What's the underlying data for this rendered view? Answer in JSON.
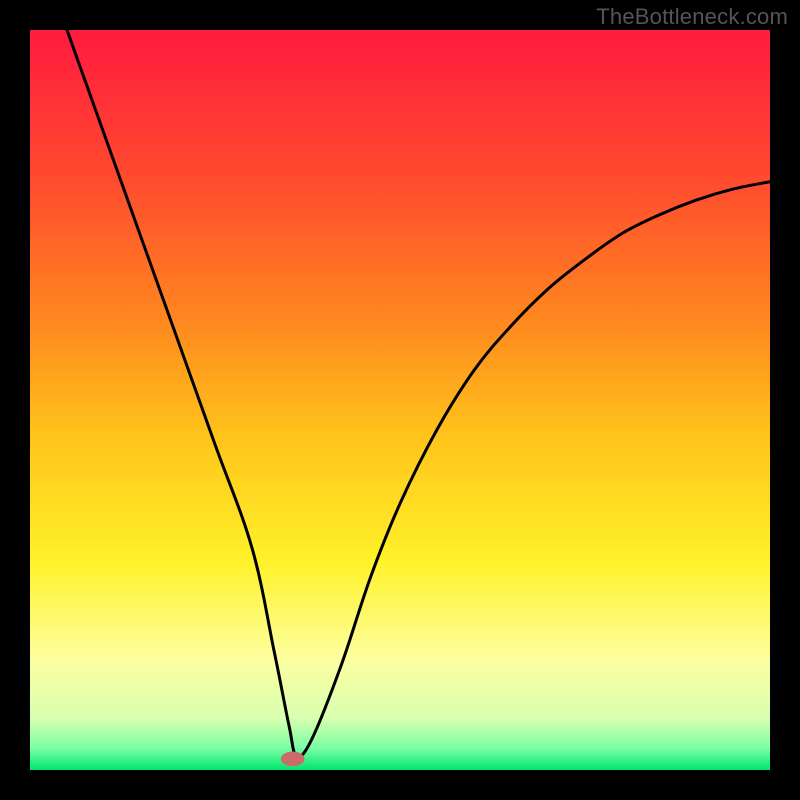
{
  "watermark": "TheBottleneck.com",
  "chart_data": {
    "type": "line",
    "title": "",
    "xlabel": "",
    "ylabel": "",
    "xlim": [
      0,
      100
    ],
    "ylim": [
      0,
      100
    ],
    "grid": false,
    "legend": false,
    "gradient_stops": [
      {
        "offset": 0.0,
        "color": "#ff1b3f"
      },
      {
        "offset": 0.2,
        "color": "#ff4a2e"
      },
      {
        "offset": 0.4,
        "color": "#ff8a1f"
      },
      {
        "offset": 0.55,
        "color": "#ffc41a"
      },
      {
        "offset": 0.72,
        "color": "#fff22a"
      },
      {
        "offset": 0.85,
        "color": "#fdffa0"
      },
      {
        "offset": 0.93,
        "color": "#d8ffb0"
      },
      {
        "offset": 0.97,
        "color": "#7bffa5"
      },
      {
        "offset": 1.0,
        "color": "#00e66e"
      }
    ],
    "series": [
      {
        "name": "bottleneck-curve",
        "x": [
          5,
          10,
          15,
          20,
          25,
          30,
          33,
          35,
          36,
          38,
          42,
          46,
          50,
          55,
          60,
          65,
          70,
          75,
          80,
          85,
          90,
          95,
          100
        ],
        "y": [
          100,
          86,
          72,
          58,
          44,
          30,
          16,
          6,
          2,
          4,
          14,
          26,
          36,
          46,
          54,
          60,
          65,
          69,
          72.5,
          75,
          77,
          78.5,
          79.5
        ]
      }
    ],
    "marker": {
      "x": 35.5,
      "y": 1.5,
      "rx": 1.6,
      "ry": 1.0
    }
  }
}
